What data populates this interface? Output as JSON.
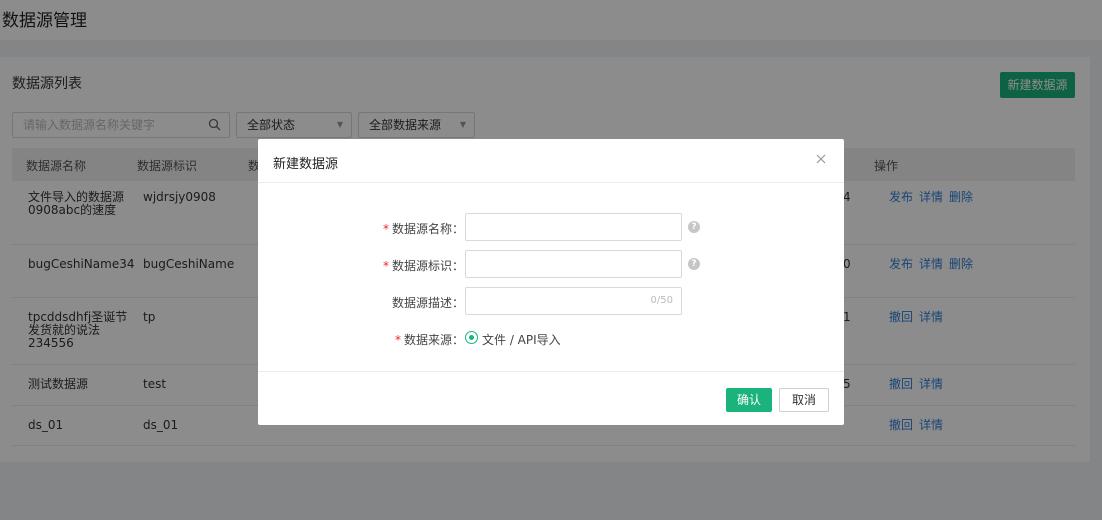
{
  "page": {
    "title": "数据源管理"
  },
  "list": {
    "title": "数据源列表",
    "new_button": "新建数据源",
    "search_placeholder": "请输入数据源名称关键字",
    "status_filter": "全部状态",
    "source_filter": "全部数据来源"
  },
  "table": {
    "headers": [
      "数据源名称",
      "数据源标识",
      "数",
      "操作"
    ],
    "rows": [
      {
        "name": "文件导入的数据源0908abc的速度",
        "id": "wjdrsjy0908",
        "tail": "4",
        "actions": [
          "发布",
          "详情",
          "删除"
        ]
      },
      {
        "name": "bugCeshiName34",
        "id": "bugCeshiName",
        "tail": "0",
        "actions": [
          "发布",
          "详情",
          "删除"
        ]
      },
      {
        "name": "tpcddsdhfj圣诞节发货就的说法234556",
        "id": "tp",
        "tail": "1",
        "actions": [
          "撤回",
          "详情"
        ]
      },
      {
        "name": "测试数据源",
        "id": "test",
        "tail": "5",
        "actions": [
          "撤回",
          "详情"
        ]
      },
      {
        "name": "ds_01",
        "id": "ds_01",
        "tail": "",
        "actions": [
          "撤回",
          "详情"
        ]
      }
    ]
  },
  "modal": {
    "title": "新建数据源",
    "fields": {
      "name_label": "数据源名称：",
      "id_label": "数据源标识：",
      "desc_label": "数据源描述：",
      "desc_counter": "0/50",
      "source_label": "数据来源：",
      "source_option": "文件 / API导入"
    },
    "confirm": "确认",
    "cancel": "取消"
  },
  "colors": {
    "accent": "#19b37b",
    "link": "#2f7fd8",
    "required": "#f5222d"
  }
}
